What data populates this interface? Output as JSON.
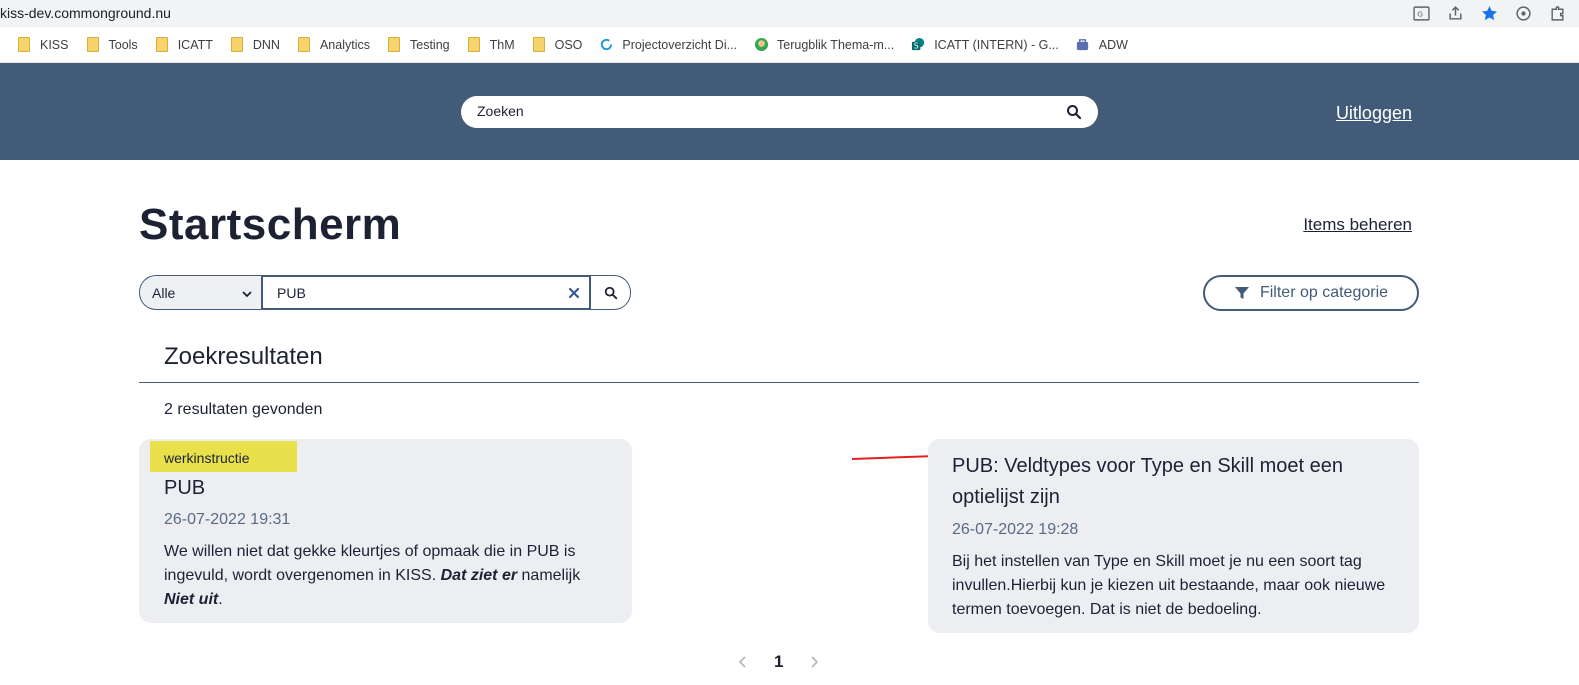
{
  "browser": {
    "url": "kiss-dev.commonground.nu",
    "bookmarks": [
      {
        "label": "KISS",
        "icon": "folder-icon"
      },
      {
        "label": "Tools",
        "icon": "folder-icon"
      },
      {
        "label": "ICATT",
        "icon": "folder-icon"
      },
      {
        "label": "DNN",
        "icon": "folder-icon"
      },
      {
        "label": "Analytics",
        "icon": "folder-icon"
      },
      {
        "label": "Testing",
        "icon": "folder-icon"
      },
      {
        "label": "ThM",
        "icon": "folder-icon"
      },
      {
        "label": "OSO",
        "icon": "folder-icon"
      },
      {
        "label": "Projectoverzicht Di...",
        "icon": "sync-icon"
      },
      {
        "label": "Terugblik Thema-m...",
        "icon": "avatar-icon"
      },
      {
        "label": "ICATT (INTERN) - G...",
        "icon": "sharepoint-icon"
      },
      {
        "label": "ADW",
        "icon": "bag-icon"
      }
    ]
  },
  "header": {
    "search_placeholder": "Zoeken",
    "logout_label": "Uitloggen"
  },
  "page": {
    "title": "Startscherm",
    "manage_items_label": "Items beheren",
    "scope_select_value": "Alle",
    "query_value": "PUB",
    "filter_label": "Filter op categorie",
    "results_heading": "Zoekresultaten",
    "results_count": "2 resultaten gevonden"
  },
  "results": [
    {
      "tag": "werkinstructie",
      "title": "PUB",
      "date": "26-07-2022 19:31",
      "body_part1": "We willen niet dat gekke kleurtjes of opmaak die in PUB is ingevuld, wordt overgenomen in KISS. ",
      "body_bold1": "Dat ziet er",
      "body_part2": " namelijk ",
      "body_bold2": "Niet uit",
      "body_part3": "."
    },
    {
      "title": "PUB: Veldtypes voor Type en Skill moet een optielijst zijn",
      "date": "26-07-2022 19:28",
      "body": "Bij het instellen van Type en Skill moet je nu een soort tag invullen.Hierbij kun je kiezen uit bestaande, maar ook nieuwe termen toevoegen. Dat is niet de bedoeling."
    }
  ],
  "pagination": {
    "current_page": "1"
  },
  "colors": {
    "header_bg": "#425b78",
    "tag_bg": "#e8e14b",
    "card_bg": "#eceef2",
    "annotation_arrow": "#e02020"
  }
}
